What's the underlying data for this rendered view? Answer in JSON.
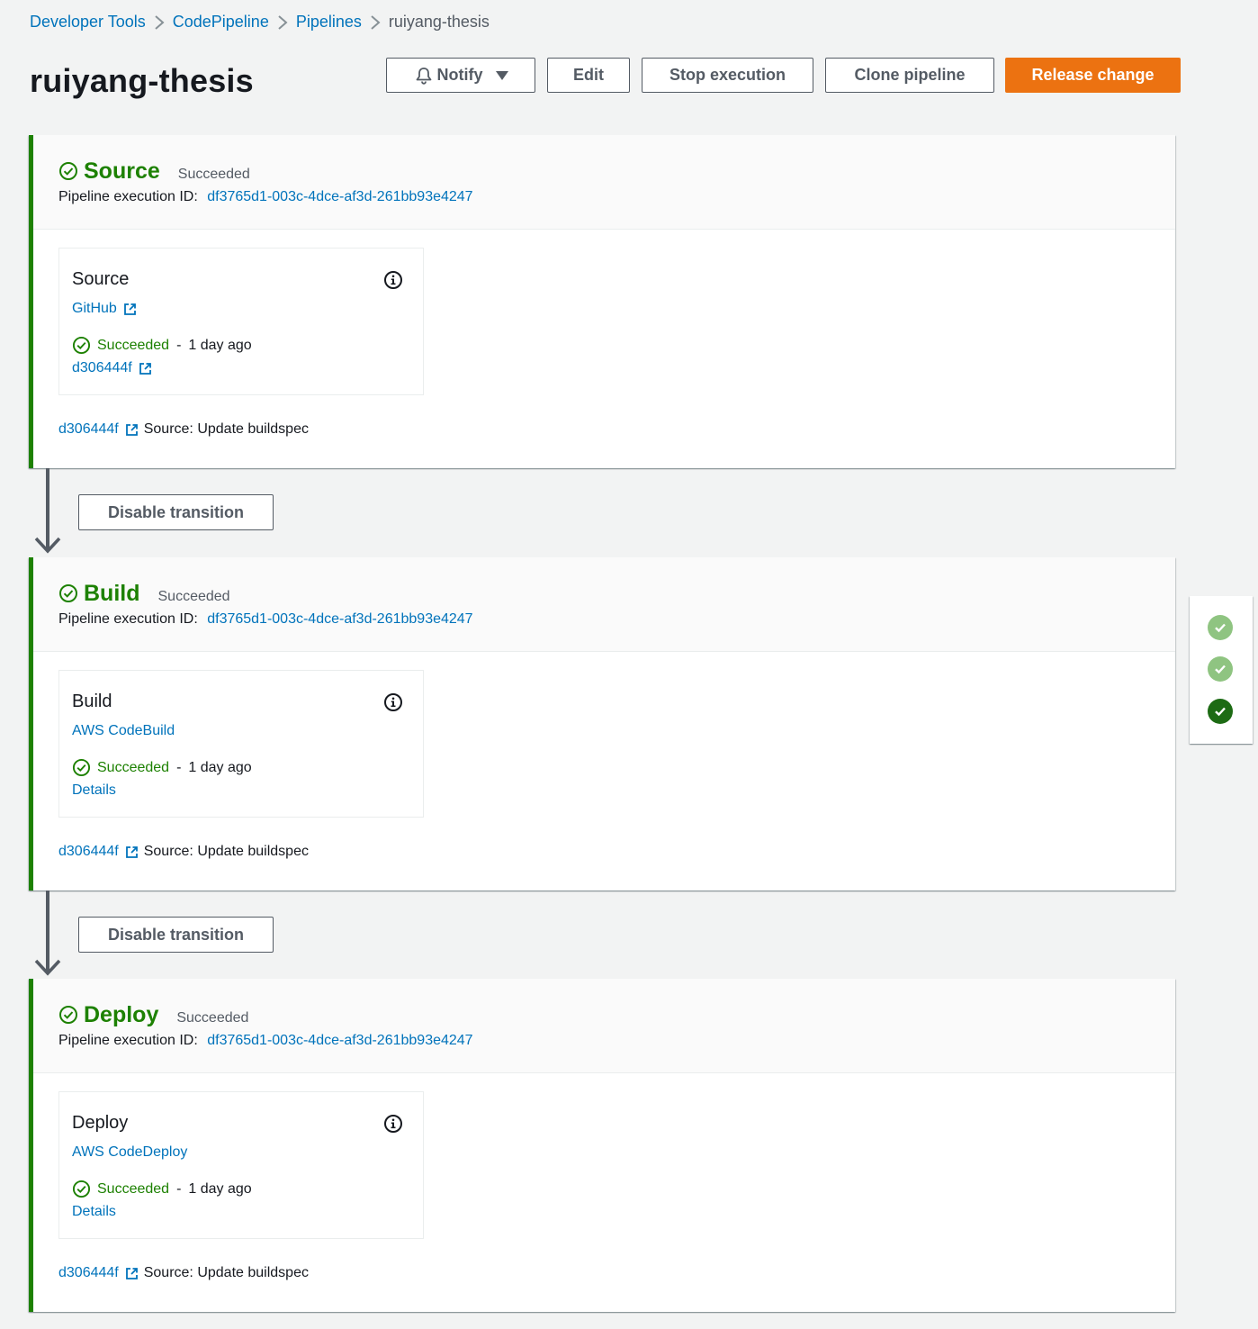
{
  "breadcrumb": {
    "items": [
      "Developer Tools",
      "CodePipeline",
      "Pipelines",
      "ruiyang-thesis"
    ]
  },
  "header": {
    "title": "ruiyang-thesis",
    "buttons": {
      "notify": "Notify",
      "edit": "Edit",
      "stop": "Stop execution",
      "clone": "Clone pipeline",
      "release": "Release change"
    }
  },
  "colors": {
    "success": "#1d8102",
    "link": "#0073bb",
    "primary_button": "#ec7211",
    "nav_done_light": "#8fc481"
  },
  "stages": [
    {
      "name": "Source",
      "status": "Succeeded",
      "exec_label": "Pipeline execution ID:",
      "exec_id": "df3765d1-003c-4dce-af3d-261bb93e4247",
      "action": {
        "name": "Source",
        "provider": "GitHub",
        "status": "Succeeded",
        "dash": "-",
        "time": "1 day ago",
        "detail": "d306444f"
      },
      "commit": {
        "id": "d306444f",
        "message": "Source: Update buildspec"
      }
    },
    {
      "name": "Build",
      "status": "Succeeded",
      "exec_label": "Pipeline execution ID:",
      "exec_id": "df3765d1-003c-4dce-af3d-261bb93e4247",
      "action": {
        "name": "Build",
        "provider": "AWS CodeBuild",
        "status": "Succeeded",
        "dash": "-",
        "time": "1 day ago",
        "detail": "Details"
      },
      "commit": {
        "id": "d306444f",
        "message": "Source: Update buildspec"
      }
    },
    {
      "name": "Deploy",
      "status": "Succeeded",
      "exec_label": "Pipeline execution ID:",
      "exec_id": "df3765d1-003c-4dce-af3d-261bb93e4247",
      "action": {
        "name": "Deploy",
        "provider": "AWS CodeDeploy",
        "status": "Succeeded",
        "dash": "-",
        "time": "1 day ago",
        "detail": "Details"
      },
      "commit": {
        "id": "d306444f",
        "message": "Source: Update buildspec"
      }
    }
  ],
  "transitions": [
    "Disable transition",
    "Disable transition"
  ],
  "icons": {
    "breadcrumb_separator": "chevron-right-icon",
    "notify": "bell-icon",
    "notify_caret": "caret-down-icon",
    "stage_status": "check-circle-icon",
    "info": "info-icon",
    "external": "external-link-icon",
    "transition": "arrow-down-icon",
    "stage_nav": "check-circle-icon"
  }
}
